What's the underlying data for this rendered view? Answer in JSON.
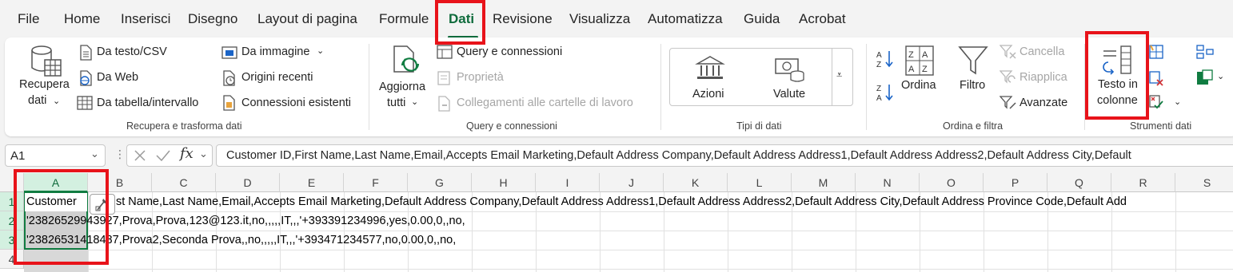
{
  "menu": {
    "tabs": [
      "File",
      "Home",
      "Inserisci",
      "Disegno",
      "Layout di pagina",
      "Formule",
      "Dati",
      "Revisione",
      "Visualizza",
      "Automatizza",
      "Guida",
      "Acrobat"
    ],
    "active": "Dati"
  },
  "ribbon": {
    "get_data": {
      "recupera_line1": "Recupera",
      "recupera_line2": "dati",
      "da_testo": "Da testo/CSV",
      "da_web": "Da Web",
      "da_tabella": "Da tabella/intervallo",
      "da_immagine": "Da immagine",
      "origini_recenti": "Origini recenti",
      "connessioni_esistenti": "Connessioni esistenti",
      "group_label": "Recupera e trasforma dati"
    },
    "queries": {
      "aggiorna_line1": "Aggiorna",
      "aggiorna_line2": "tutti",
      "query_connessioni": "Query e connessioni",
      "proprieta": "Proprietà",
      "collegamenti": "Collegamenti alle cartelle di lavoro",
      "group_label": "Query e connessioni"
    },
    "data_types": {
      "azioni": "Azioni",
      "valute": "Valute",
      "group_label": "Tipi di dati"
    },
    "sort_filter": {
      "ordina": "Ordina",
      "filtro": "Filtro",
      "cancella": "Cancella",
      "riapplica": "Riapplica",
      "avanzate": "Avanzate",
      "group_label": "Ordina e filtra"
    },
    "tools": {
      "testo_line1": "Testo in",
      "testo_line2": "colonne",
      "group_label": "Strumenti dati"
    }
  },
  "formula_bar": {
    "name_box": "A1",
    "fx": "fx",
    "content": "Customer ID,First Name,Last Name,Email,Accepts Email Marketing,Default Address Company,Default Address Address1,Default Address Address2,Default Address City,Default"
  },
  "grid": {
    "columns": [
      "A",
      "B",
      "C",
      "D",
      "E",
      "F",
      "G",
      "H",
      "I",
      "J",
      "K",
      "L",
      "M",
      "N",
      "O",
      "P",
      "Q",
      "R",
      "S"
    ],
    "rows": [
      "1",
      "2",
      "3",
      "4"
    ],
    "cells": {
      "r1_a": "Customer",
      "r1_rest": "st Name,Last Name,Email,Accepts Email Marketing,Default Address Company,Default Address Address1,Default Address Address2,Default Address City,Default Address Province Code,Default Add",
      "r2": "'23826529943927,Prova,Prova,123@123.it,no,,,,,IT,,,'+393391234996,yes,0.00,0,,no,",
      "r3": "'23826531418487,Prova2,Seconda Prova,,no,,,,,IT,,,'+393471234577,no,0.00,0,,no,"
    }
  }
}
